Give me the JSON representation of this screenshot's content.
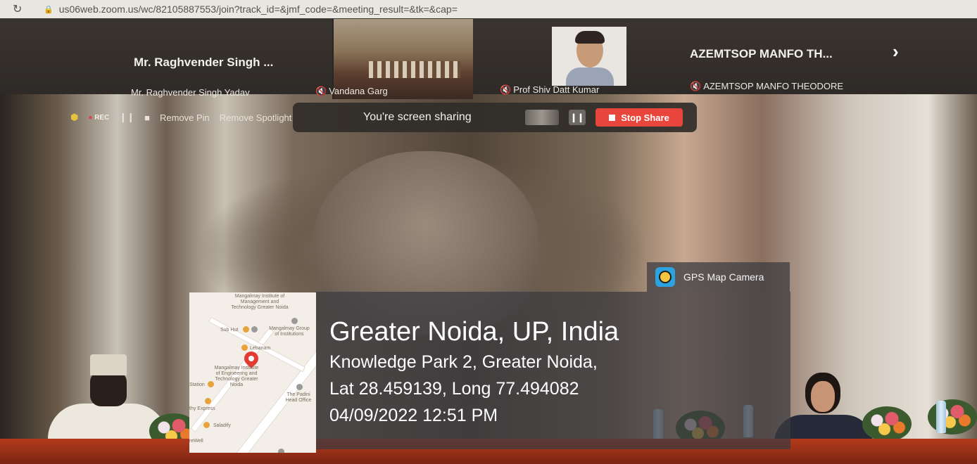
{
  "browser": {
    "url": "us06web.zoom.us/wc/82105887553/join?track_id=&jmf_code=&meeting_result=&tk=&cap="
  },
  "gallery": {
    "tiles": [
      {
        "display_name": "Mr. Raghvender Singh ...",
        "sub_name": "Mr. Raghvender Singh Yadav",
        "muted": false
      },
      {
        "sub_name": "Vandana Garg",
        "muted": true
      },
      {
        "sub_name": "Prof Shiv Datt Kumar",
        "muted": true
      },
      {
        "display_name": "AZEMTSOP MANFO TH...",
        "sub_name": "AZEMTSOP MANFO THEODORE",
        "muted": true
      }
    ]
  },
  "toolbar": {
    "rec_label": "REC",
    "remove_pin": "Remove Pin",
    "remove_spotlight": "Remove Spotlight"
  },
  "share_bar": {
    "status": "You're screen sharing",
    "stop_label": "Stop Share"
  },
  "gps": {
    "app_label": "GPS Map Camera",
    "city": "Greater Noida, UP, India",
    "address": "Knowledge Park 2, Greater Noida,",
    "coords": "Lat 28.459139, Long 77.494082",
    "datetime": "04/09/2022 12:51 PM",
    "map_pois": {
      "mangalmay_mgmt": "Mangalmay Institute of Management and Technology Greater Noida",
      "sub_hut": "Sub Hut",
      "mangalmay_group": "Mangalmay Group of Institutions",
      "lebanam": "Lebanam",
      "mangalmay_engg": "Mangalmay Institute of Engineering and Technology Greater Noida",
      "station": "Station",
      "the_padini": "The Padini Head Office",
      "express": "thy Express",
      "saladify": "Saladify",
      "wellness": "reWell"
    },
    "colors": {
      "pin": "#e23b32",
      "poi": "#e8a23c"
    }
  },
  "colors": {
    "stop_share": "#e8453c",
    "muted_icon": "#e8434b",
    "shield": "#e7c23b"
  }
}
